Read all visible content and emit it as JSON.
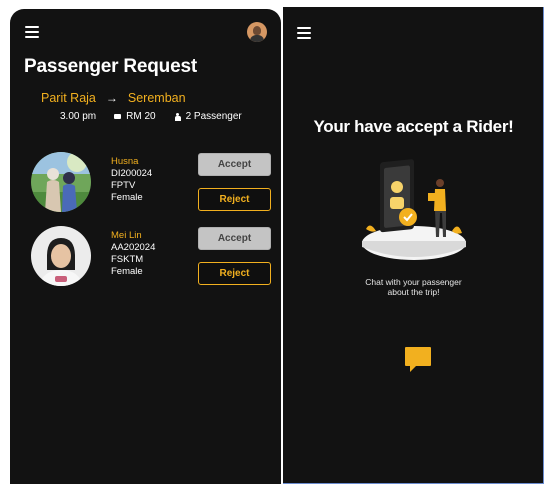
{
  "left_screen": {
    "title": "Passenger Request",
    "route": {
      "from": "Parit Raja",
      "arrow": "→",
      "to": "Seremban"
    },
    "meta": {
      "time": "3.00 pm",
      "price": "RM 20",
      "passengers": "2 Passenger"
    },
    "requests": [
      {
        "name": "Husna",
        "id": "DI200024",
        "faculty": "FPTV",
        "gender": "Female",
        "accept_label": "Accept",
        "reject_label": "Reject"
      },
      {
        "name": "Mei Lin",
        "id": "AA202024",
        "faculty": "FSKTM",
        "gender": "Female",
        "accept_label": "Accept",
        "reject_label": "Reject"
      }
    ]
  },
  "right_screen": {
    "title": "Your have accept a Rider!",
    "caption_line1": "Chat with your passenger",
    "caption_line2": "about the trip!"
  },
  "colors": {
    "accent": "#f2b01f",
    "background": "#121212",
    "button_gray": "#c4c4c4"
  },
  "icons": [
    "menu-icon",
    "user-avatar",
    "arrow-icon",
    "cash-icon",
    "person-icon",
    "chat-icon"
  ]
}
